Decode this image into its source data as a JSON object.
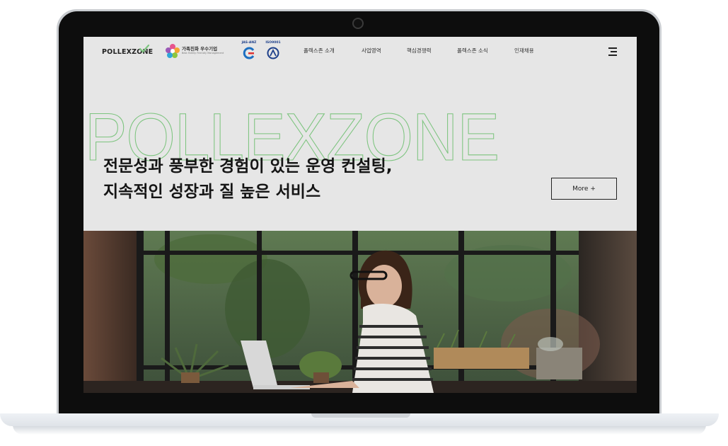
{
  "brand": {
    "name": "POLLEXZONE",
    "family_company": "가족친화 우수기업",
    "family_company_sub": "Best Family Friendly Management",
    "cert1_label": "JAS-ANZ",
    "cert2_label": "ISO9001"
  },
  "nav": {
    "items": [
      "폴렉스존 소개",
      "사업영역",
      "핵심경쟁력",
      "폴렉스존 소식",
      "인재채용"
    ]
  },
  "hero": {
    "outline_text": "POLLEXZONE",
    "line1": "전문성과 풍부한 경험이 있는 운영 컨설팅,",
    "line2": "지속적인 성장과 질 높은 서비스",
    "more_label": "More +"
  },
  "colors": {
    "accent_green": "#7dc47f",
    "screen_bg": "#e6e6e6",
    "text_dark": "#151515"
  }
}
